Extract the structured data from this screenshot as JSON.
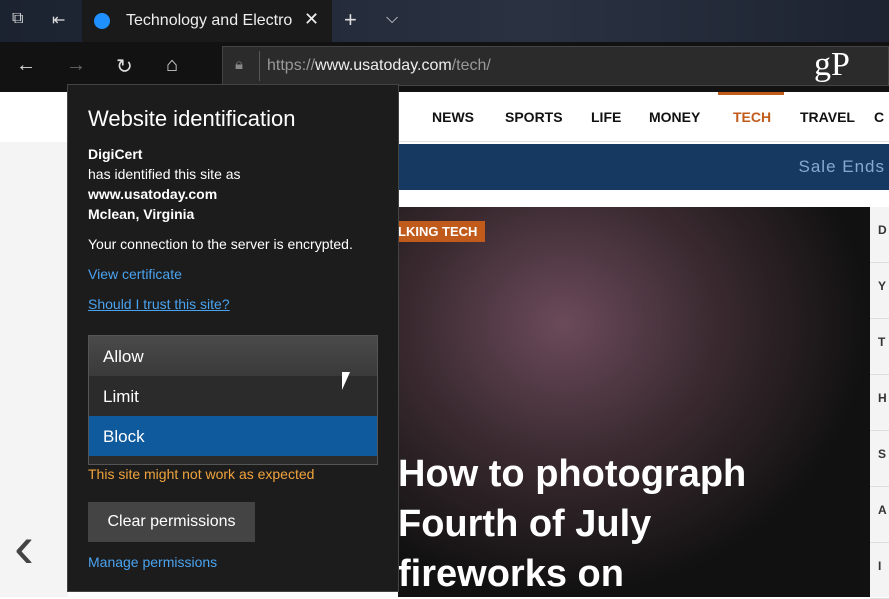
{
  "browser": {
    "tab_title": "Technology and Electro",
    "url_scheme": "https://",
    "url_host": "www.usatoday.com",
    "url_path": "/tech/",
    "watermark": "gP"
  },
  "site": {
    "menu": [
      "NEWS",
      "SPORTS",
      "LIFE",
      "MONEY",
      "TECH",
      "TRAVEL",
      "C"
    ],
    "active_menu": "TECH",
    "banner": "Sale Ends",
    "badge": "LKING TECH",
    "headline": [
      "How to photograph",
      "Fourth of July",
      "fireworks on"
    ],
    "sidebar_letters": [
      "D",
      "Y",
      "T",
      "H",
      "S",
      "A",
      "I"
    ]
  },
  "flyout": {
    "title": "Website identification",
    "issuer": "DigiCert",
    "identified": "has identified this site as",
    "domain": "www.usatoday.com",
    "location": "Mclean, Virginia",
    "encrypted": "Your connection to the server is encrypted.",
    "view_cert": "View certificate",
    "trust": "Should I trust this site?",
    "options": [
      "Allow",
      "Limit",
      "Block"
    ],
    "selected": "Block",
    "warning": "This site might not work as expected",
    "clear": "Clear permissions",
    "manage": "Manage permissions"
  },
  "colors": {
    "accent": "#c15b1c",
    "link": "#4aa3f0",
    "selected": "#0f5a9c",
    "warning": "#f0a33c"
  }
}
